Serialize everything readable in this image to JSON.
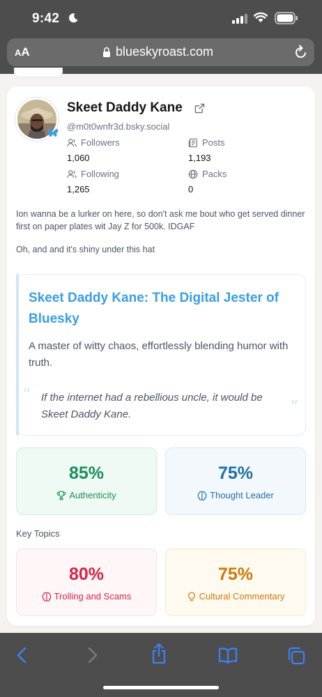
{
  "status": {
    "time": "9:42"
  },
  "browser": {
    "text_size_small": "A",
    "text_size_big": "A",
    "url": "blueskyroast.com"
  },
  "profile": {
    "name": "Skeet Daddy Kane",
    "handle": "@m0t0wnfr3d.bsky.social",
    "stats": [
      {
        "label": "Followers",
        "value": "1,060",
        "icon": "users-icon"
      },
      {
        "label": "Posts",
        "value": "1,193",
        "icon": "newspaper-icon"
      },
      {
        "label": "Following",
        "value": "1,265",
        "icon": "users-icon"
      },
      {
        "label": "Packs",
        "value": "0",
        "icon": "globe-icon"
      }
    ],
    "bio": [
      "Ion wanna be a lurker on here, so don't ask me bout who get served dinner first on paper plates wit Jay Z for 500k. IDGAF",
      "Oh, and and it's shiny under this hat"
    ]
  },
  "roast": {
    "title": "Skeet Daddy Kane: The Digital Jester of Bluesky",
    "subtitle": "A master of witty chaos, effortlessly blending humor with truth.",
    "quote": "If the internet had a rebellious uncle, it would be Skeet Daddy Kane.",
    "quote_open": "“",
    "quote_close": "”"
  },
  "metrics": [
    {
      "value": "85%",
      "label": "Authenticity",
      "icon": "trophy-icon",
      "color": "#1a8f5c",
      "bg": "#eefaf3",
      "border": "#d3efdf"
    },
    {
      "value": "75%",
      "label": "Thought Leader",
      "icon": "brain-icon",
      "color": "#1f6fa8",
      "bg": "#f3f8fd",
      "border": "#d9e8f5"
    }
  ],
  "key_topics": {
    "heading": "Key Topics",
    "items": [
      {
        "value": "80%",
        "label": "Trolling and Scams",
        "icon": "brain-icon",
        "color": "#d52447",
        "bg": "#fef6f7",
        "border": "#f8e1e4"
      },
      {
        "value": "75%",
        "label": "Cultural Commentary",
        "icon": "lightbulb-icon",
        "color": "#cc7a0a",
        "bg": "#fffaf0",
        "border": "#f7ead0"
      }
    ]
  },
  "colors": {
    "accent": "#3a9ee4",
    "chrome": "#4d4d4d",
    "ios_blue": "#3b82f6"
  }
}
